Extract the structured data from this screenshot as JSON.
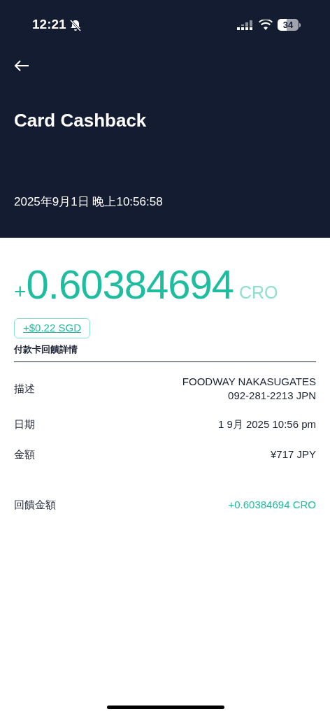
{
  "status_bar": {
    "time": "12:21",
    "battery": "34"
  },
  "header": {
    "title": "Card Cashback",
    "timestamp": "2025年9月1日 晚上10:56:58"
  },
  "amount": {
    "sign": "+",
    "value": "0.60384694",
    "currency": "CRO",
    "fiat": "+$0.22 SGD"
  },
  "section_title": "付款卡回饋詳情",
  "details": [
    {
      "label": "描述",
      "value": [
        "FOODWAY NAKASUGATES",
        "092-281-2213 JPN"
      ],
      "kind": "plain"
    },
    {
      "label": "日期",
      "value": [
        "1 9月 2025 10:56 pm"
      ],
      "kind": "plain"
    },
    {
      "label": "金額",
      "value": [
        "¥717 JPY"
      ],
      "kind": "plain"
    },
    {
      "label": "回饋金額",
      "value": [
        "+0.60384694 CRO"
      ],
      "kind": "highlight"
    }
  ]
}
